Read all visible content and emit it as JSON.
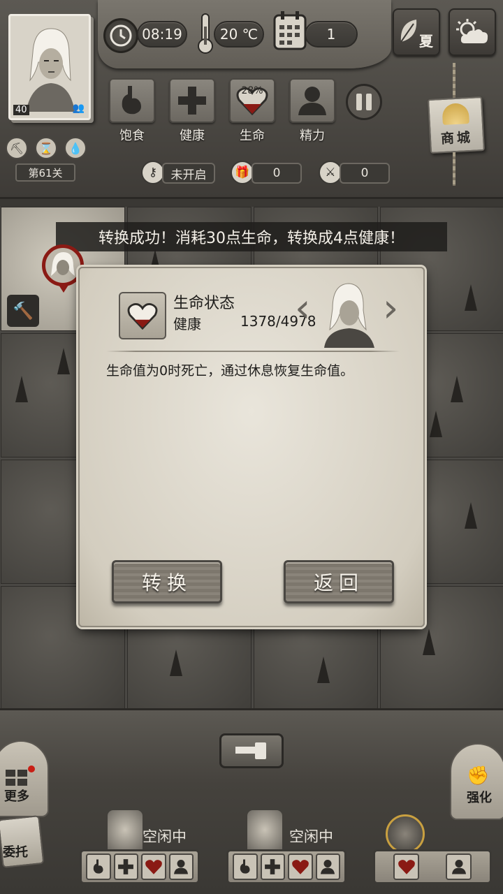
{
  "hud": {
    "time": "08:19",
    "temperature": "20 ℃",
    "day": "1",
    "season": "夏",
    "level_number": "40",
    "stage": "第61关",
    "stats": [
      {
        "label": "饱食"
      },
      {
        "label": "健康"
      },
      {
        "label": "生命",
        "percent": "28%"
      },
      {
        "label": "精力"
      }
    ],
    "shop_label": "商城",
    "key_status": "未开启",
    "gift_count": "0",
    "battle_count": "0"
  },
  "toast": "转换成功！消耗30点生命，转换成4点健康！",
  "dialog": {
    "title": "生命状态",
    "subtitle": "健康",
    "value": "1378/4978",
    "description": "生命值为0时死亡，通过休息恢复生命值。",
    "convert_label": "转换",
    "back_label": "返回"
  },
  "bottom": {
    "more_label": "更多",
    "delegate_label": "委托",
    "strengthen_label": "强化",
    "workers": [
      {
        "status": "空闲中"
      },
      {
        "status": "空闲中"
      }
    ]
  },
  "colors": {
    "accent_red": "#8a1a14",
    "parchment": "#e9e5db",
    "wood": "#7d776d"
  }
}
